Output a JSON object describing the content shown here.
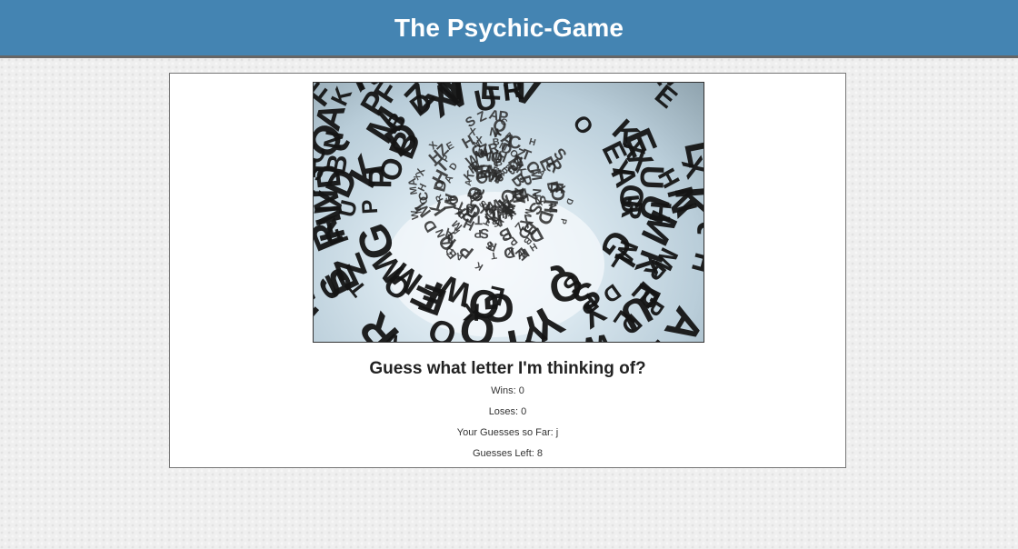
{
  "header": {
    "title": "The Psychic-Game"
  },
  "hero": {
    "image": "letters-sculpture-image",
    "letters_outer": [
      "M",
      "E",
      "D",
      "X",
      "Z",
      "O",
      "B",
      "N",
      "C",
      "K",
      "A",
      "P",
      "S",
      "W",
      "R",
      "G",
      "L",
      "T",
      "H",
      "Y",
      "Q",
      "F",
      "V",
      "U"
    ],
    "letters_inner": [
      "E",
      "R",
      "A",
      "N",
      "O",
      "M",
      "C",
      "T",
      "S",
      "D",
      "B",
      "X",
      "P",
      "Q",
      "W",
      "K",
      "Z",
      "H"
    ]
  },
  "game": {
    "prompt": "Guess what letter I'm thinking of?",
    "wins": {
      "label": "Wins",
      "value": "0"
    },
    "losses": {
      "label": "Loses",
      "value": "0"
    },
    "guesses_so_far": {
      "label": "Your Guesses so Far",
      "value": "j"
    },
    "guesses_left": {
      "label": "Guesses Left",
      "value": "8"
    }
  }
}
